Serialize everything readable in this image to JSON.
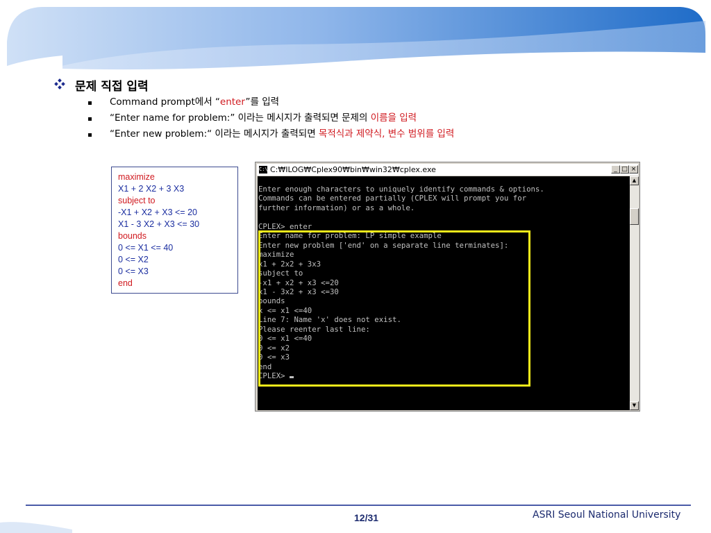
{
  "slide": {
    "title": "문제 직접 입력",
    "bullets": [
      {
        "parts": [
          {
            "t": "Command prompt에서 “"
          },
          {
            "t": "enter",
            "red": true
          },
          {
            "t": "”를 입력"
          }
        ]
      },
      {
        "parts": [
          {
            "t": "“Enter name for problem:” 이라는 메시지가 출력되면 문제의 "
          },
          {
            "t": "이름을 입력",
            "red": true
          }
        ]
      },
      {
        "parts": [
          {
            "t": "“Enter new problem:“ 이라는 메시지가 출력되면 "
          },
          {
            "t": "목적식과 제약식, 변수 범위를 입력",
            "red": true
          }
        ]
      }
    ],
    "page_number": "12/31",
    "organization": "ASRI Seoul National University"
  },
  "lp_box": {
    "lines": [
      {
        "t": "maximize",
        "kw": true
      },
      {
        "t": "X1 + 2 X2 + 3 X3",
        "kw": false
      },
      {
        "t": "subject to",
        "kw": true
      },
      {
        "t": "-X1 + X2 + X3 <= 20",
        "kw": false
      },
      {
        "t": "X1 - 3 X2 + X3 <= 30",
        "kw": false
      },
      {
        "t": "bounds",
        "kw": true
      },
      {
        "t": "0 <= X1 <= 40",
        "kw": false
      },
      {
        "t": "0 <= X2",
        "kw": false
      },
      {
        "t": "0 <= X3",
        "kw": false
      },
      {
        "t": "end",
        "kw": true
      }
    ]
  },
  "console": {
    "window_title": "C:₩ILOG₩Cplex90₩bin₩win32₩cplex.exe",
    "icon_label": "C:\\",
    "buttons": {
      "minimize": "_",
      "maximize": "□",
      "close": "×"
    },
    "lines": [
      "Enter enough characters to uniquely identify commands & options.",
      "Commands can be entered partially (CPLEX will prompt you for",
      "further information) or as a whole.",
      "",
      "CPLEX> enter",
      "Enter name for problem: LP simple example",
      "Enter new problem ['end' on a separate line terminates]:",
      "maximize",
      "x1 + 2x2 + 3x3",
      "subject to",
      "-x1 + x2 + x3 <=20",
      "x1 - 3x2 + x3 <=30",
      "bounds",
      "x <= x1 <=40",
      "Line 7: Name 'x' does not exist.",
      "Please reenter last line:",
      "0 <= x1 <=40",
      "0 <= x2",
      "0 <= x3",
      "end",
      "CPLEX> "
    ],
    "highlight_color": "#f5ee1a"
  },
  "colors": {
    "accent_red": "#d0191f",
    "header_blue": "#2a6fc9",
    "footer_blue": "#1b2a6e"
  }
}
